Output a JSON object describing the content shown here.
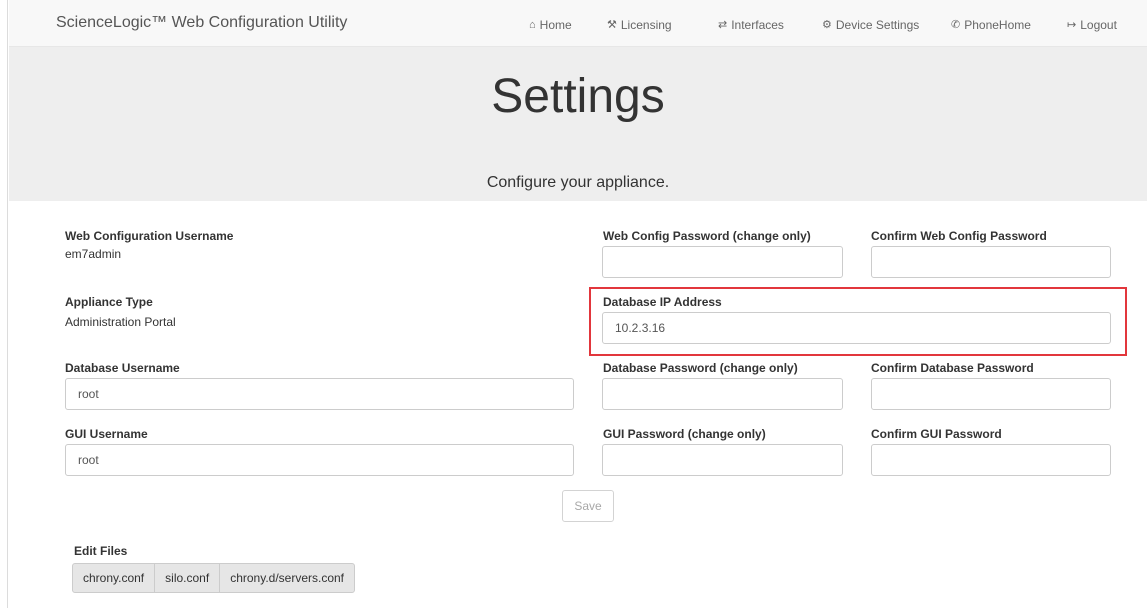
{
  "navbar": {
    "brand": "ScienceLogic™ Web Configuration Utility",
    "items": [
      {
        "label": "Home",
        "icon": "home-icon",
        "glyph": "⌂"
      },
      {
        "label": "Licensing",
        "icon": "gavel-icon",
        "glyph": "⚒"
      },
      {
        "label": "Interfaces",
        "icon": "transfer-icon",
        "glyph": "⇄"
      },
      {
        "label": "Device Settings",
        "icon": "gear-icon",
        "glyph": "⚙"
      },
      {
        "label": "PhoneHome",
        "icon": "phone-icon",
        "glyph": "✆"
      },
      {
        "label": "Logout",
        "icon": "logout-icon",
        "glyph": "↦"
      }
    ]
  },
  "header": {
    "title": "Settings",
    "subtitle": "Configure your appliance."
  },
  "form": {
    "web_config_username_label": "Web Configuration Username",
    "web_config_username_value": "em7admin",
    "web_config_password_label": "Web Config Password (change only)",
    "web_config_password_value": "",
    "confirm_web_config_password_label": "Confirm Web Config Password",
    "confirm_web_config_password_value": "",
    "appliance_type_label": "Appliance Type",
    "appliance_type_value": "Administration Portal",
    "database_ip_label": "Database IP Address",
    "database_ip_value": "10.2.3.16",
    "database_username_label": "Database Username",
    "database_username_value": "root",
    "database_password_label": "Database Password (change only)",
    "database_password_value": "",
    "confirm_database_password_label": "Confirm Database Password",
    "confirm_database_password_value": "",
    "gui_username_label": "GUI Username",
    "gui_username_value": "root",
    "gui_password_label": "GUI Password (change only)",
    "gui_password_value": "",
    "confirm_gui_password_label": "Confirm GUI Password",
    "confirm_gui_password_value": "",
    "save_label": "Save"
  },
  "edit_files": {
    "label": "Edit Files",
    "files": [
      "chrony.conf",
      "silo.conf",
      "chrony.d/servers.conf"
    ]
  },
  "colors": {
    "highlight": "#e2363c",
    "navbar_bg": "#f8f8f8",
    "jumbotron_bg": "#eeeeee"
  }
}
